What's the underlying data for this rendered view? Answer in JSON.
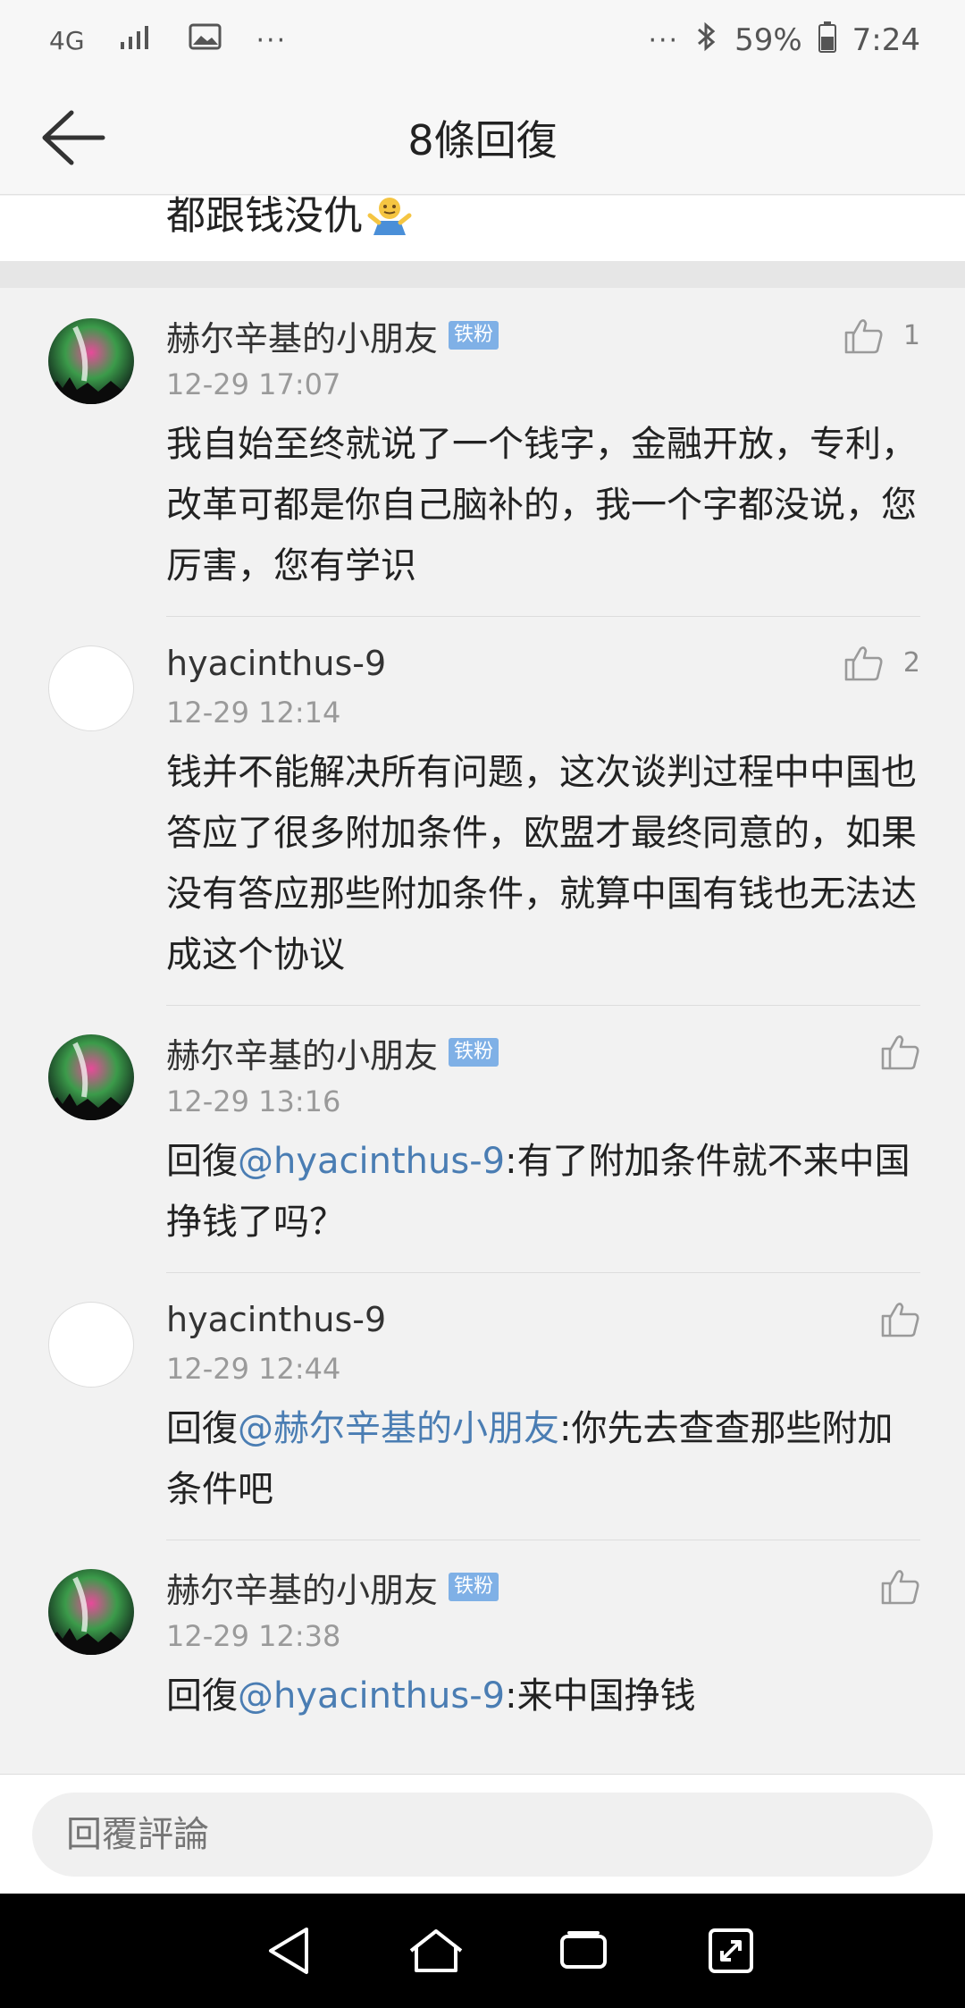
{
  "status_bar": {
    "network": "4G",
    "dots_left": "···",
    "dots_right": "···",
    "battery": "59%",
    "time": "7:24"
  },
  "header": {
    "title": "8條回復"
  },
  "root_comment": {
    "tail_text": "都跟钱没仇"
  },
  "comments": [
    {
      "username": "赫尔辛基的小朋友",
      "badge": "铁粉",
      "timestamp": "12-29 17:07",
      "likes": "1",
      "text": "我自始至终就说了一个钱字，金融开放，专利，改革可都是你自己脑补的，我一个字都没说，您厉害，您有学识"
    },
    {
      "username": "hyacinthus-9",
      "timestamp": "12-29 12:14",
      "likes": "2",
      "text": "钱并不能解决所有问题，这次谈判过程中中国也答应了很多附加条件，欧盟才最终同意的，如果没有答应那些附加条件，就算中国有钱也无法达成这个协议"
    },
    {
      "username": "赫尔辛基的小朋友",
      "badge": "铁粉",
      "timestamp": "12-29 13:16",
      "reply_prefix": "回復",
      "mention": "@hyacinthus-9",
      "text": ":有了附加条件就不来中国挣钱了吗？"
    },
    {
      "username": "hyacinthus-9",
      "timestamp": "12-29 12:44",
      "reply_prefix": "回復",
      "mention": "@赫尔辛基的小朋友",
      "text": ":你先去查查那些附加条件吧"
    },
    {
      "username": "赫尔辛基的小朋友",
      "badge": "铁粉",
      "timestamp": "12-29 12:38",
      "reply_prefix": "回復",
      "mention": "@hyacinthus-9",
      "text": ":来中国挣钱"
    }
  ],
  "reply_bar": {
    "placeholder": "回覆評論"
  },
  "colors": {
    "mention": "#4a7db3",
    "badge": "#7fb0e6",
    "background": "#f2f2f2"
  }
}
